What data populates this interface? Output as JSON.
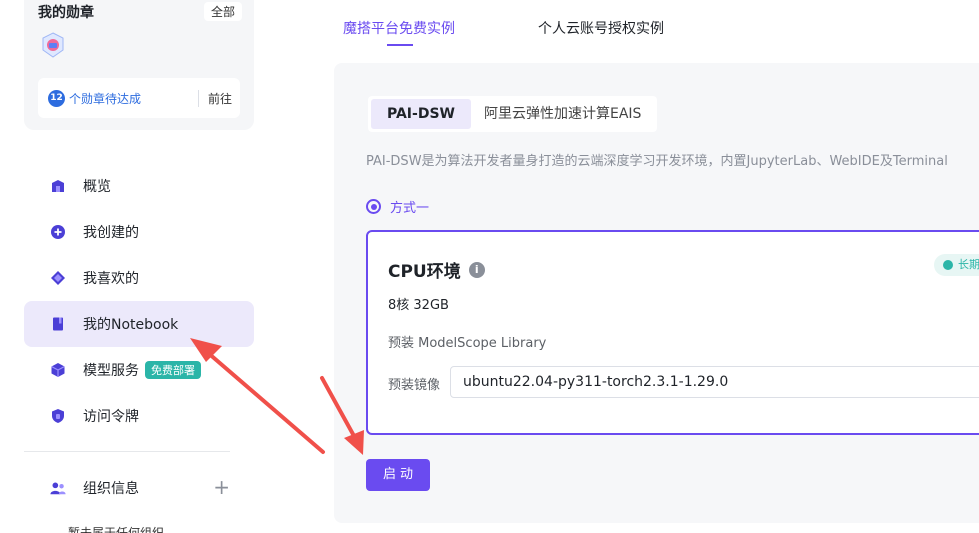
{
  "badges": {
    "title": "我的勋章",
    "all_label": "全部",
    "pending_count": "12",
    "pending_text": "个勋章待达成",
    "go_label": "前往"
  },
  "nav": {
    "items": [
      {
        "label": "概览",
        "icon": "overview-icon"
      },
      {
        "label": "我创建的",
        "icon": "plus-circle-icon"
      },
      {
        "label": "我喜欢的",
        "icon": "diamond-icon"
      },
      {
        "label": "我的Notebook",
        "icon": "notebook-icon",
        "active": true
      },
      {
        "label": "模型服务",
        "icon": "cube-icon",
        "tag": "免费部署"
      },
      {
        "label": "访问令牌",
        "icon": "shield-icon"
      }
    ],
    "org_label": "组织信息",
    "org_note": "暂未属于任何组织"
  },
  "tabs": {
    "free_instance": "魔搭平台免费实例",
    "personal_instance": "个人云账号授权实例"
  },
  "sub_tabs": {
    "dsw": "PAI-DSW",
    "eais": "阿里云弹性加速计算EAIS"
  },
  "description": "PAI-DSW是为算法开发者量身打造的云端深度学习开发环境，内置JupyterLab、WebIDE及Terminal",
  "method_label": "方式一",
  "card": {
    "title": "CPU环境",
    "pill": "长期",
    "spec": "8核 32GB",
    "library": "预装 ModelScope Library",
    "image_label": "预装镜像",
    "image_value": "ubuntu22.04-py311-torch2.3.1-1.29.0"
  },
  "start_label": "启动",
  "colors": {
    "accent": "#6a4bf0",
    "annotation_arrow": "#f0504a",
    "tag_teal": "#2bb5a8"
  }
}
